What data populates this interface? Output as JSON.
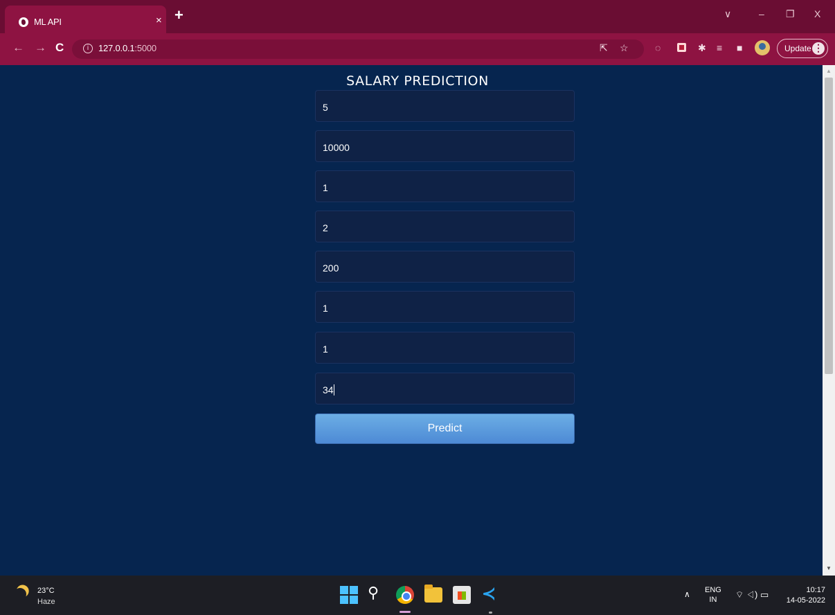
{
  "browser": {
    "tab_title": "ML API",
    "tab_close": "×",
    "new_tab": "+",
    "url_host": "127.0.0.1",
    "url_port": ":5000",
    "update_label": "Update",
    "window_controls": {
      "dropdown": "∨",
      "minimize": "–",
      "restore": "❐",
      "close": "X"
    }
  },
  "page": {
    "heading": "SALARY PREDICTION",
    "fields": [
      "5",
      "10000",
      "1",
      "2",
      "200",
      "1",
      "1",
      "34"
    ],
    "predict_label": "Predict"
  },
  "taskbar": {
    "temperature": "23°C",
    "weather": "Haze",
    "language_line1": "ENG",
    "language_line2": "IN",
    "time": "10:17",
    "date": "14-05-2022"
  },
  "colors": {
    "page_background": "#06254f",
    "browser_chrome": "#8e1342",
    "button": "#5b9be0"
  }
}
